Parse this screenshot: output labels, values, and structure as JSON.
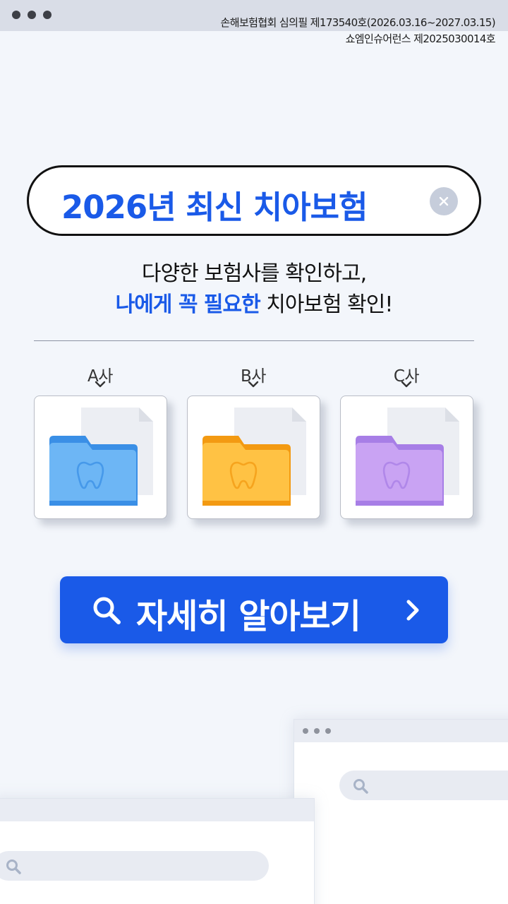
{
  "window": {
    "legal_line1": "손해보험협회 심의필 제173540호(2026.03.16~2027.03.15)",
    "legal_line2": "쇼엠인슈어런스 제2025030014호"
  },
  "search": {
    "query": "2026년 최신 치아보험",
    "clear_icon": "close-icon"
  },
  "headline": {
    "line1": "다양한 보험사를 확인하고,",
    "line2_highlight": "나에게 꼭 필요한",
    "line2_rest": " 치아보험 확인!"
  },
  "insurers": [
    {
      "label": "A사",
      "folder_color": "#6db6f5",
      "folder_dark": "#3a8fe6",
      "icon": "tooth-folder-icon"
    },
    {
      "label": "B사",
      "folder_color": "#ffc244",
      "folder_dark": "#f39a12",
      "icon": "tooth-folder-icon"
    },
    {
      "label": "C사",
      "folder_color": "#c9a3f3",
      "folder_dark": "#a77ee6",
      "icon": "tooth-folder-icon"
    }
  ],
  "cta": {
    "label": "자세히 알아보기",
    "icon": "search-icon",
    "arrow": "chevron-right-icon"
  },
  "colors": {
    "accent": "#1a5ae8",
    "background": "#f3f6fb"
  }
}
